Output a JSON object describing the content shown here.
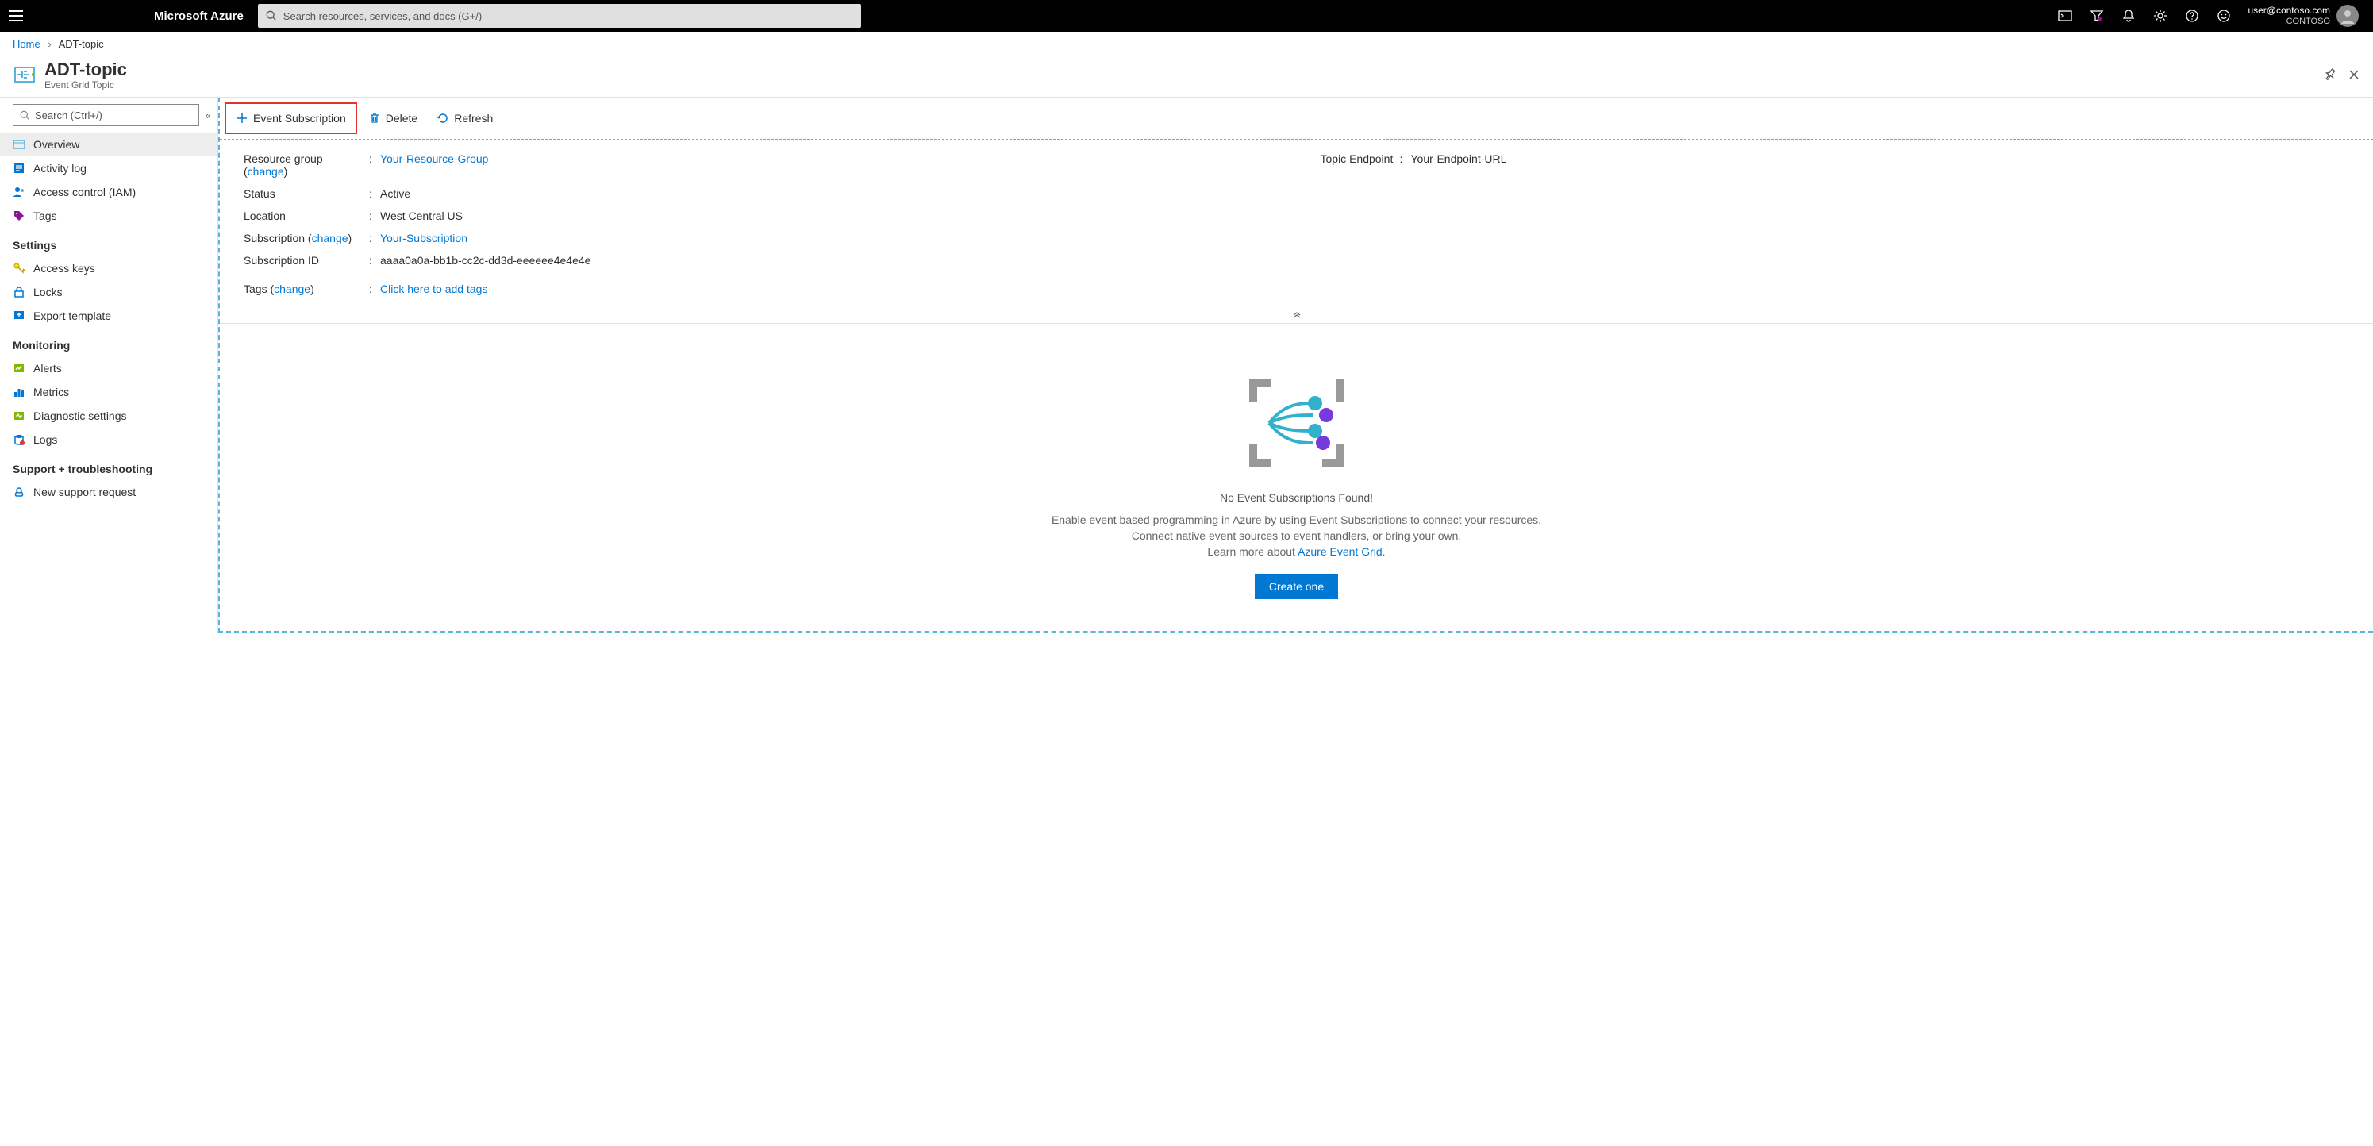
{
  "topbar": {
    "brand": "Microsoft Azure",
    "search_placeholder": "Search resources, services, and docs (G+/)",
    "user_email": "user@contoso.com",
    "user_org": "CONTOSO"
  },
  "breadcrumb": {
    "home": "Home",
    "current": "ADT-topic"
  },
  "header": {
    "title": "ADT-topic",
    "subtitle": "Event Grid Topic"
  },
  "sidebar": {
    "search_placeholder": "Search (Ctrl+/)",
    "items": {
      "overview": "Overview",
      "activity_log": "Activity log",
      "access_control": "Access control (IAM)",
      "tags": "Tags"
    },
    "sections": {
      "settings": "Settings",
      "settings_items": {
        "access_keys": "Access keys",
        "locks": "Locks",
        "export_template": "Export template"
      },
      "monitoring": "Monitoring",
      "monitoring_items": {
        "alerts": "Alerts",
        "metrics": "Metrics",
        "diagnostic_settings": "Diagnostic settings",
        "logs": "Logs"
      },
      "support": "Support + troubleshooting",
      "support_items": {
        "new_request": "New support request"
      }
    }
  },
  "toolbar": {
    "event_subscription": "Event Subscription",
    "delete": "Delete",
    "refresh": "Refresh"
  },
  "essentials": {
    "labels": {
      "resource_group": "Resource group",
      "status": "Status",
      "location": "Location",
      "subscription": "Subscription",
      "subscription_id": "Subscription ID",
      "tags": "Tags",
      "topic_endpoint": "Topic Endpoint",
      "change": "change"
    },
    "values": {
      "resource_group": "Your-Resource-Group",
      "status": "Active",
      "location": "West Central US",
      "subscription": "Your-Subscription",
      "subscription_id": "aaaa0a0a-bb1b-cc2c-dd3d-eeeeee4e4e4e",
      "tags": "Click here to add tags",
      "topic_endpoint": "Your-Endpoint-URL"
    }
  },
  "empty": {
    "title": "No Event Subscriptions Found!",
    "desc1": "Enable event based programming in Azure by using Event Subscriptions to connect your resources.",
    "desc2": "Connect native event sources to event handlers, or bring your own.",
    "desc3_prefix": "Learn more about ",
    "desc3_link": "Azure Event Grid",
    "create_button": "Create one"
  }
}
